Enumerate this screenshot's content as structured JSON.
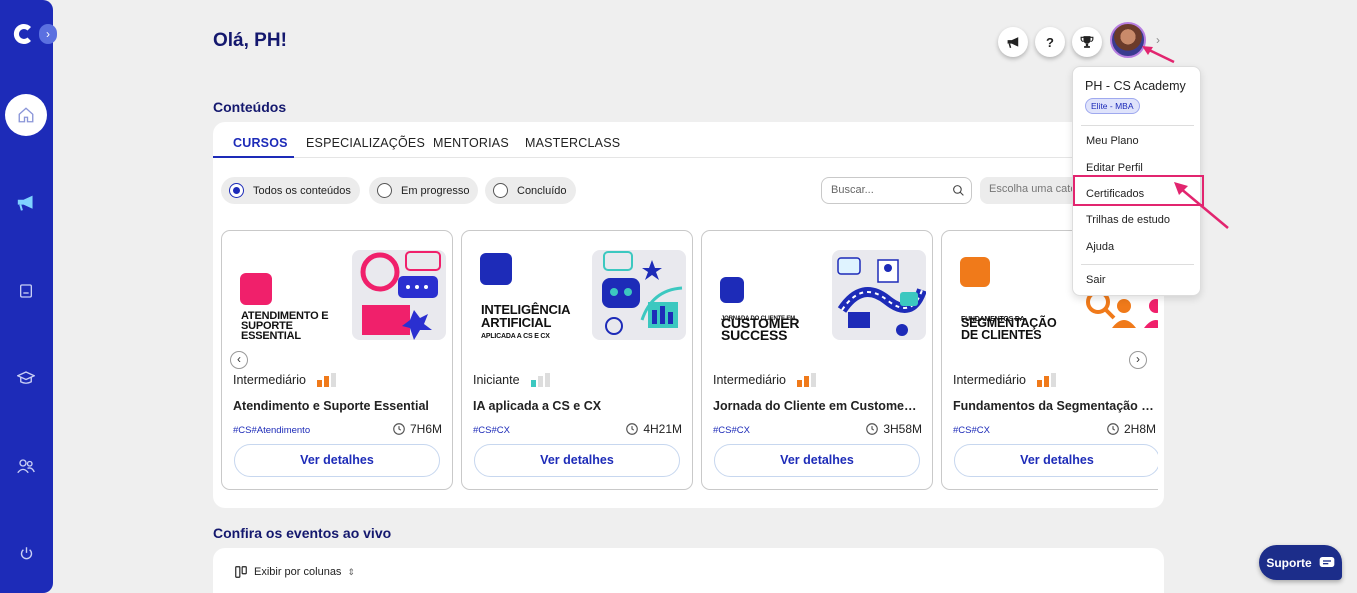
{
  "header": {
    "greeting": "Olá, PH!"
  },
  "sections": {
    "contents_title": "Conteúdos",
    "events_title": "Confira os eventos ao vivo"
  },
  "tabs": [
    {
      "label": "CURSOS",
      "active": true
    },
    {
      "label": "ESPECIALIZAÇÕES",
      "active": false
    },
    {
      "label": "MENTORIAS",
      "active": false
    },
    {
      "label": "MASTERCLASS",
      "active": false
    }
  ],
  "filters": [
    {
      "label": "Todos os conteúdos",
      "selected": true
    },
    {
      "label": "Em progresso",
      "selected": false
    },
    {
      "label": "Concluído",
      "selected": false
    }
  ],
  "search": {
    "placeholder": "Buscar..."
  },
  "category": {
    "placeholder": "Escolha uma categoria"
  },
  "cards": [
    {
      "thumb_title": "Atendimento e Suporte Essential",
      "level": "Intermediário",
      "level_value": 2,
      "title": "Atendimento e Suporte Essential",
      "tags": "#CS#Atendimento",
      "duration": "7H6M",
      "button": "Ver detalhes"
    },
    {
      "thumb_title": "Inteligência Artificial",
      "thumb_subtitle": "Aplicada a CS e CX",
      "level": "Iniciante",
      "level_value": 1,
      "title": "IA aplicada a CS e CX",
      "tags": "#CS#CX",
      "duration": "4H21M",
      "button": "Ver detalhes"
    },
    {
      "thumb_title_small": "Jornada do Cliente em",
      "thumb_title": "Customer Success",
      "level": "Intermediário",
      "level_value": 2,
      "title": "Jornada do Cliente em Customer Success",
      "tags": "#CS#CX",
      "duration": "3H58M",
      "button": "Ver detalhes"
    },
    {
      "thumb_title_small": "Fundamentos da",
      "thumb_title": "Segmentação de Clientes",
      "level": "Intermediário",
      "level_value": 2,
      "title": "Fundamentos da Segmentação de Clientes",
      "tags": "#CS#CX",
      "duration": "2H8M",
      "button": "Ver detalhes"
    }
  ],
  "events": {
    "view_label": "Exibir por colunas"
  },
  "user_menu": {
    "name": "PH - CS Academy",
    "plan_badge": "Elite - MBA",
    "items": [
      "Meu Plano",
      "Editar Perfil",
      "Certificados",
      "Trilhas de estudo",
      "Ajuda"
    ],
    "logout": "Sair",
    "highlighted_item": "Certificados"
  },
  "support": {
    "label": "Suporte"
  },
  "colors": {
    "brand_blue": "#1d2bb8",
    "navy": "#14186e",
    "annotation_pink": "#e2256f",
    "level_orange": "#f07a1a",
    "level_teal": "#3cc8c0"
  },
  "icons": {
    "sidebar": [
      "logo-icon",
      "home-icon",
      "megaphone-icon",
      "book-icon",
      "graduation-cap-icon",
      "users-icon",
      "power-icon"
    ],
    "topbar": [
      "megaphone-icon",
      "help-icon",
      "trophy-icon"
    ]
  }
}
